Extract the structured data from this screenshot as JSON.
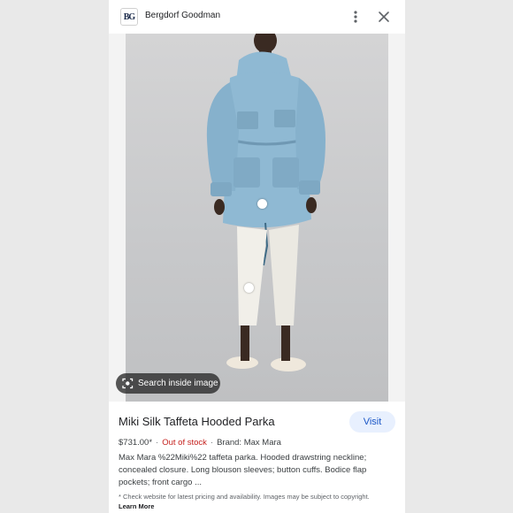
{
  "header": {
    "logo_text": "BG",
    "site_name": "Bergdorf Goodman",
    "menu_icon": "more-vert-icon",
    "close_icon": "close-icon"
  },
  "image": {
    "search_chip_label": "Search inside image",
    "search_chip_icon": "lens-icon"
  },
  "product": {
    "title": "Miki Silk Taffeta Hooded Parka",
    "visit_label": "Visit",
    "price": "$731.00*",
    "stock_status": "Out of stock",
    "brand": "Brand: Max Mara",
    "separator": "·",
    "description": "Max Mara %22Miki%22 taffeta parka. Hooded drawstring neckline; concealed closure. Long blouson sleeves; button cuffs. Bodice flap pockets; front cargo ...",
    "disclaimer": "* Check website for latest pricing and availability. Images may be subject to copyright.",
    "learn_more": "Learn More"
  },
  "colors": {
    "accent": "#1a56c6",
    "visit_bg": "#e8f0fe",
    "out_of_stock": "#c5221f",
    "parka": "#8fb9d3",
    "pants": "#f1efe9"
  }
}
